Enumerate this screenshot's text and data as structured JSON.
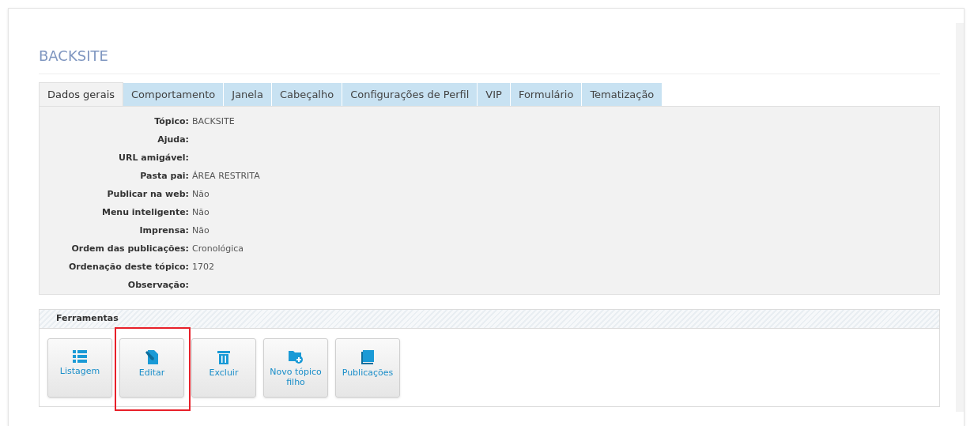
{
  "title": "BACKSITE",
  "tabs": [
    {
      "label": "Dados gerais",
      "selected": true
    },
    {
      "label": "Comportamento",
      "selected": false
    },
    {
      "label": "Janela",
      "selected": false
    },
    {
      "label": "Cabeçalho",
      "selected": false
    },
    {
      "label": "Configurações de Perfil",
      "selected": false
    },
    {
      "label": "VIP",
      "selected": false
    },
    {
      "label": "Formulário",
      "selected": false
    },
    {
      "label": "Tematização",
      "selected": false
    }
  ],
  "fields": [
    {
      "label": "Tópico:",
      "value": "BACKSITE"
    },
    {
      "label": "Ajuda:"
    },
    {
      "label": "URL amigável:"
    },
    {
      "label": "Pasta pai:",
      "value": "ÁREA RESTRITA"
    },
    {
      "label": "Publicar na web:",
      "value": "Não"
    },
    {
      "label": "Menu inteligente:",
      "value": "Não"
    },
    {
      "label": "Imprensa:",
      "value": "Não"
    },
    {
      "label": "Ordem das publicações:",
      "value": "Cronológica"
    },
    {
      "label": "Ordenação deste tópico:",
      "value": "1702"
    },
    {
      "label": "Observação:"
    }
  ],
  "tools": {
    "title": "Ferramentas",
    "buttons": [
      {
        "kind": "list",
        "label": "Listagem",
        "highlighted": false
      },
      {
        "kind": "edit",
        "label": "Editar",
        "highlighted": true
      },
      {
        "kind": "delete",
        "label": "Excluir",
        "highlighted": false
      },
      {
        "kind": "newfolder",
        "label": "Novo tópico filho",
        "highlighted": false
      },
      {
        "kind": "book",
        "label": "Publicações",
        "highlighted": false
      }
    ]
  }
}
